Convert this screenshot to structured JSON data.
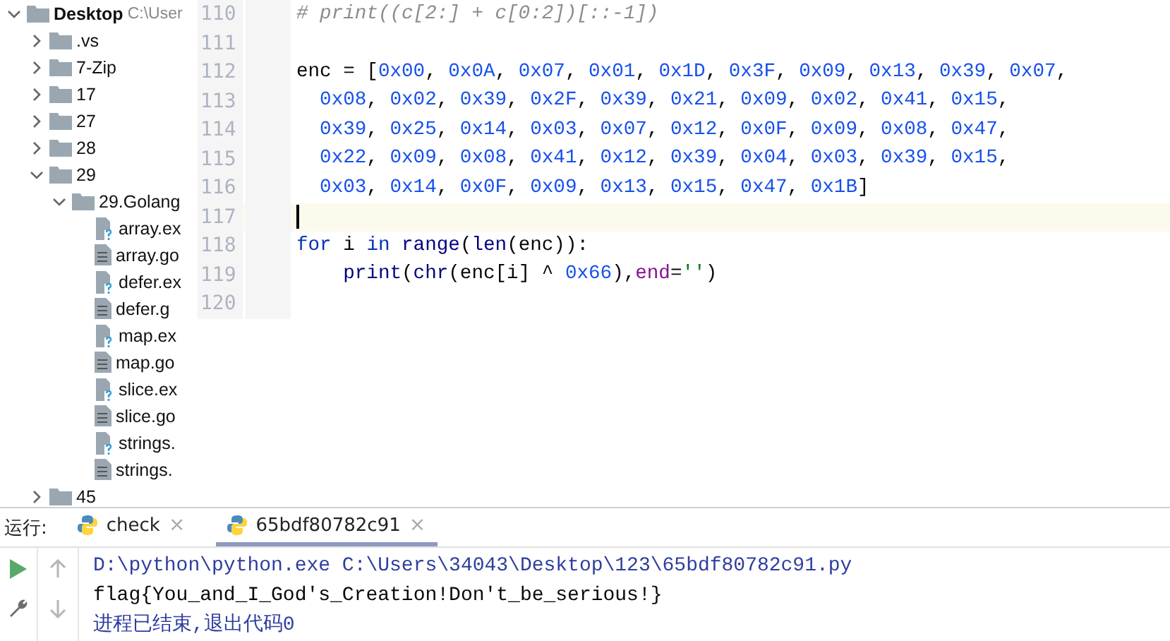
{
  "project_tree": {
    "items": [
      {
        "label": "Desktop",
        "path": "C:\\User",
        "kind": "folder",
        "expanded": true,
        "children": [
          {
            "label": ".vs",
            "kind": "folder",
            "expanded": false
          },
          {
            "label": "7-Zip",
            "kind": "folder",
            "expanded": false
          },
          {
            "label": "17",
            "kind": "folder",
            "expanded": false
          },
          {
            "label": "27",
            "kind": "folder",
            "expanded": false
          },
          {
            "label": "28",
            "kind": "folder",
            "expanded": false
          },
          {
            "label": "29",
            "kind": "folder",
            "expanded": true,
            "children": [
              {
                "label": "29.Golang",
                "kind": "folder",
                "expanded": true,
                "children": [
                  {
                    "label": "array.ex",
                    "kind": "unknown-file"
                  },
                  {
                    "label": "array.go",
                    "kind": "text-file"
                  },
                  {
                    "label": "defer.ex",
                    "kind": "unknown-file"
                  },
                  {
                    "label": "defer.g",
                    "kind": "text-file"
                  },
                  {
                    "label": "map.ex",
                    "kind": "unknown-file"
                  },
                  {
                    "label": "map.go",
                    "kind": "text-file"
                  },
                  {
                    "label": "slice.ex",
                    "kind": "unknown-file"
                  },
                  {
                    "label": "slice.go",
                    "kind": "text-file"
                  },
                  {
                    "label": "strings.",
                    "kind": "unknown-file"
                  },
                  {
                    "label": "strings.",
                    "kind": "text-file"
                  }
                ]
              }
            ]
          },
          {
            "label": "45",
            "kind": "folder",
            "expanded": false
          }
        ]
      }
    ]
  },
  "editor": {
    "lines": [
      {
        "number": "110",
        "kind": "statement",
        "current": false,
        "tokens": [
          {
            "kind": "comment",
            "text": "# print((c[2:] + c[0:2])[::-1])"
          }
        ]
      },
      {
        "number": "111",
        "kind": "statement",
        "current": false
      },
      {
        "number": "112",
        "kind": "statement",
        "current": false,
        "tokens": [
          {
            "kind": "plain",
            "text": "enc = ["
          },
          {
            "kind": "num",
            "text": "0x00"
          },
          {
            "kind": "plain",
            "text": ", "
          },
          {
            "kind": "num",
            "text": "0x0A"
          },
          {
            "kind": "plain",
            "text": ", "
          },
          {
            "kind": "num",
            "text": "0x07"
          },
          {
            "kind": "plain",
            "text": ", "
          },
          {
            "kind": "num",
            "text": "0x01"
          },
          {
            "kind": "plain",
            "text": ", "
          },
          {
            "kind": "num",
            "text": "0x1D"
          },
          {
            "kind": "plain",
            "text": ", "
          },
          {
            "kind": "num",
            "text": "0x3F"
          },
          {
            "kind": "plain",
            "text": ", "
          },
          {
            "kind": "num",
            "text": "0x09"
          },
          {
            "kind": "plain",
            "text": ", "
          },
          {
            "kind": "num",
            "text": "0x13"
          },
          {
            "kind": "plain",
            "text": ", "
          },
          {
            "kind": "num",
            "text": "0x39"
          },
          {
            "kind": "plain",
            "text": ", "
          },
          {
            "kind": "num",
            "text": "0x07"
          },
          {
            "kind": "plain",
            "text": ","
          }
        ]
      },
      {
        "number": "113",
        "kind": "continuation",
        "current": false,
        "tokens": [
          {
            "kind": "num",
            "text": "0x08"
          },
          {
            "kind": "plain",
            "text": ", "
          },
          {
            "kind": "num",
            "text": "0x02"
          },
          {
            "kind": "plain",
            "text": ", "
          },
          {
            "kind": "num",
            "text": "0x39"
          },
          {
            "kind": "plain",
            "text": ", "
          },
          {
            "kind": "num",
            "text": "0x2F"
          },
          {
            "kind": "plain",
            "text": ", "
          },
          {
            "kind": "num",
            "text": "0x39"
          },
          {
            "kind": "plain",
            "text": ", "
          },
          {
            "kind": "num",
            "text": "0x21"
          },
          {
            "kind": "plain",
            "text": ", "
          },
          {
            "kind": "num",
            "text": "0x09"
          },
          {
            "kind": "plain",
            "text": ", "
          },
          {
            "kind": "num",
            "text": "0x02"
          },
          {
            "kind": "plain",
            "text": ", "
          },
          {
            "kind": "num",
            "text": "0x41"
          },
          {
            "kind": "plain",
            "text": ", "
          },
          {
            "kind": "num",
            "text": "0x15"
          },
          {
            "kind": "plain",
            "text": ","
          }
        ]
      },
      {
        "number": "114",
        "kind": "continuation",
        "current": false,
        "tokens": [
          {
            "kind": "num",
            "text": "0x39"
          },
          {
            "kind": "plain",
            "text": ", "
          },
          {
            "kind": "num",
            "text": "0x25"
          },
          {
            "kind": "plain",
            "text": ", "
          },
          {
            "kind": "num",
            "text": "0x14"
          },
          {
            "kind": "plain",
            "text": ", "
          },
          {
            "kind": "num",
            "text": "0x03"
          },
          {
            "kind": "plain",
            "text": ", "
          },
          {
            "kind": "num",
            "text": "0x07"
          },
          {
            "kind": "plain",
            "text": ", "
          },
          {
            "kind": "num",
            "text": "0x12"
          },
          {
            "kind": "plain",
            "text": ", "
          },
          {
            "kind": "num",
            "text": "0x0F"
          },
          {
            "kind": "plain",
            "text": ", "
          },
          {
            "kind": "num",
            "text": "0x09"
          },
          {
            "kind": "plain",
            "text": ", "
          },
          {
            "kind": "num",
            "text": "0x08"
          },
          {
            "kind": "plain",
            "text": ", "
          },
          {
            "kind": "num",
            "text": "0x47"
          },
          {
            "kind": "plain",
            "text": ","
          }
        ]
      },
      {
        "number": "115",
        "kind": "continuation",
        "current": false,
        "tokens": [
          {
            "kind": "num",
            "text": "0x22"
          },
          {
            "kind": "plain",
            "text": ", "
          },
          {
            "kind": "num",
            "text": "0x09"
          },
          {
            "kind": "plain",
            "text": ", "
          },
          {
            "kind": "num",
            "text": "0x08"
          },
          {
            "kind": "plain",
            "text": ", "
          },
          {
            "kind": "num",
            "text": "0x41"
          },
          {
            "kind": "plain",
            "text": ", "
          },
          {
            "kind": "num",
            "text": "0x12"
          },
          {
            "kind": "plain",
            "text": ", "
          },
          {
            "kind": "num",
            "text": "0x39"
          },
          {
            "kind": "plain",
            "text": ", "
          },
          {
            "kind": "num",
            "text": "0x04"
          },
          {
            "kind": "plain",
            "text": ", "
          },
          {
            "kind": "num",
            "text": "0x03"
          },
          {
            "kind": "plain",
            "text": ", "
          },
          {
            "kind": "num",
            "text": "0x39"
          },
          {
            "kind": "plain",
            "text": ", "
          },
          {
            "kind": "num",
            "text": "0x15"
          },
          {
            "kind": "plain",
            "text": ","
          }
        ]
      },
      {
        "number": "116",
        "kind": "continuation",
        "current": false,
        "tokens": [
          {
            "kind": "num",
            "text": "0x03"
          },
          {
            "kind": "plain",
            "text": ", "
          },
          {
            "kind": "num",
            "text": "0x14"
          },
          {
            "kind": "plain",
            "text": ", "
          },
          {
            "kind": "num",
            "text": "0x0F"
          },
          {
            "kind": "plain",
            "text": ", "
          },
          {
            "kind": "num",
            "text": "0x09"
          },
          {
            "kind": "plain",
            "text": ", "
          },
          {
            "kind": "num",
            "text": "0x13"
          },
          {
            "kind": "plain",
            "text": ", "
          },
          {
            "kind": "num",
            "text": "0x15"
          },
          {
            "kind": "plain",
            "text": ", "
          },
          {
            "kind": "num",
            "text": "0x47"
          },
          {
            "kind": "plain",
            "text": ", "
          },
          {
            "kind": "num",
            "text": "0x1B"
          },
          {
            "kind": "plain",
            "text": "]"
          }
        ]
      },
      {
        "number": "117",
        "kind": "statement",
        "current": true
      },
      {
        "number": "118",
        "kind": "statement",
        "current": false,
        "tokens": [
          {
            "kind": "keyword",
            "text": "for"
          },
          {
            "kind": "plain",
            "text": " i "
          },
          {
            "kind": "keyword",
            "text": "in "
          },
          {
            "kind": "builtin",
            "text": "range"
          },
          {
            "kind": "plain",
            "text": "("
          },
          {
            "kind": "builtin",
            "text": "len"
          },
          {
            "kind": "plain",
            "text": "(enc)):"
          }
        ]
      },
      {
        "number": "119",
        "kind": "block",
        "current": false,
        "tokens": [
          {
            "kind": "builtin",
            "text": "print"
          },
          {
            "kind": "plain",
            "text": "("
          },
          {
            "kind": "builtin",
            "text": "chr"
          },
          {
            "kind": "plain",
            "text": "(enc[i] ^ "
          },
          {
            "kind": "num",
            "text": "0x66"
          },
          {
            "kind": "plain",
            "text": "),"
          },
          {
            "kind": "param",
            "text": "end"
          },
          {
            "kind": "plain",
            "text": "="
          },
          {
            "kind": "string",
            "text": "''"
          },
          {
            "kind": "plain",
            "text": ")"
          }
        ]
      },
      {
        "number": "120",
        "kind": "statement",
        "current": false
      }
    ]
  },
  "run_panel": {
    "label": "运行:",
    "tabs": [
      {
        "label": "check",
        "close": "×",
        "selected": false
      },
      {
        "label": "65bdf80782c91",
        "close": "×",
        "selected": true
      }
    ],
    "console": [
      {
        "kind": "command",
        "text": "D:\\python\\python.exe C:\\Users\\34043\\Desktop\\123\\65bdf80782c91.py"
      },
      {
        "kind": "output",
        "text": "flag{You_and_I_God's_Creation!Don't_be_serious!}"
      },
      {
        "kind": "exit",
        "text": "进程已结束,退出代码0"
      }
    ]
  }
}
